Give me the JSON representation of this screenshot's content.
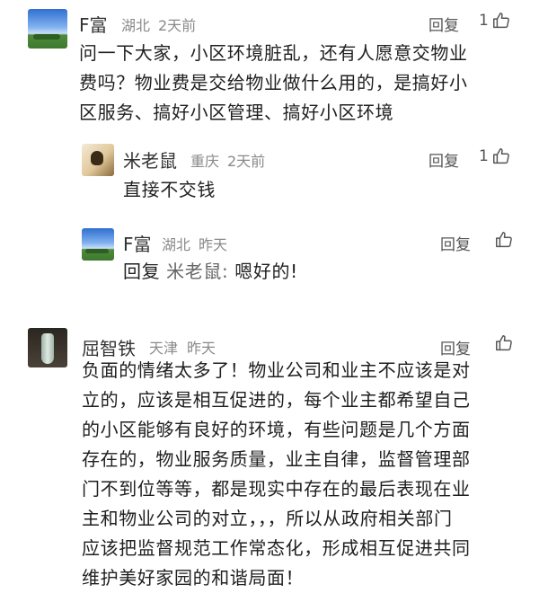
{
  "comments": [
    {
      "name": "F富",
      "location": "湖北",
      "time": "2天前",
      "reply_label": "回复",
      "likes": "1",
      "avatar_icon": "landscape-avatar",
      "text_lines": [
        "问一下大家，小区环境脏乱，还有人愿意交物业",
        "费吗？物业费是交给物业做什么用的，是搞好小",
        "区服务、搞好小区管理、搞好小区环境"
      ]
    },
    {
      "name": "米老鼠",
      "location": "重庆",
      "time": "2天前",
      "reply_label": "回复",
      "likes": "1",
      "avatar_icon": "mouse-avatar",
      "text": "直接不交钱"
    },
    {
      "name": "F富",
      "location": "湖北",
      "time": "昨天",
      "reply_label": "回复",
      "likes": "",
      "avatar_icon": "landscape-avatar",
      "text_prefix": "回复",
      "text_mention": "米老鼠:",
      "text_body": "嗯好的!"
    },
    {
      "name": "屈智铁",
      "location": "天津",
      "time": "昨天",
      "reply_label": "回复",
      "likes": "",
      "avatar_icon": "vase-avatar",
      "text_lines": [
        "负面的情绪太多了！物业公司和业主不应该是对",
        "立的，应该是相互促进的，每个业主都希望自己",
        "的小区能够有良好的环境，有些问题是几个方面",
        "存在的，物业服务质量，业主自律，监督管理部",
        "门不到位等等，都是现实中存在的最后表现在业",
        "主和物业公司的对立，，，所以从政府相关部门",
        "应该把监督规范工作常态化，形成相互促进共同",
        "维护美好家园的和谐局面！"
      ]
    }
  ],
  "colors": {
    "text": "#1f1f1f",
    "meta": "#8a8a8a",
    "action": "#555555"
  }
}
